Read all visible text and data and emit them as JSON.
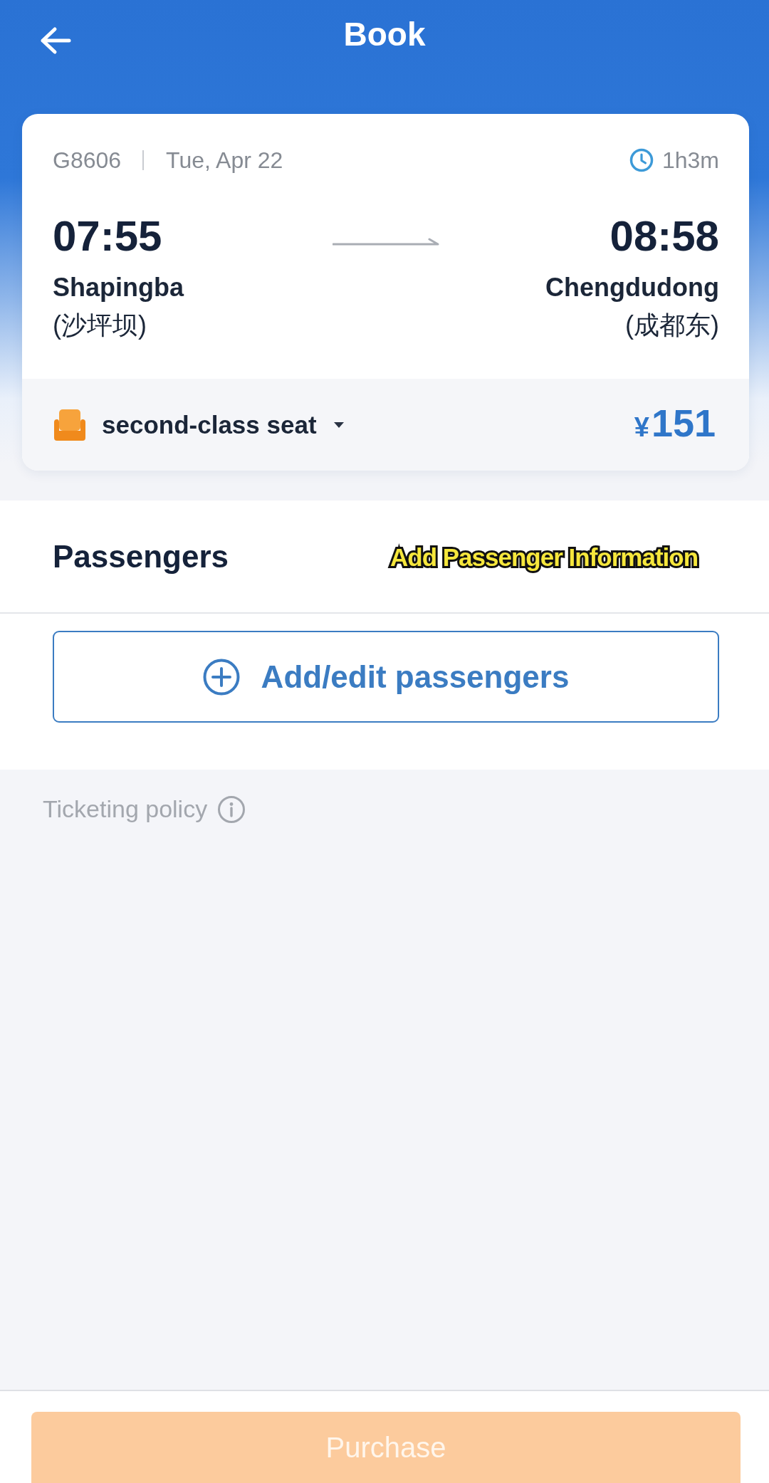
{
  "header": {
    "title": "Book"
  },
  "trip": {
    "train": "G8606",
    "date": "Tue, Apr 22",
    "duration": "1h3m",
    "departure": {
      "time": "07:55",
      "station": "Shapingba",
      "station_local": "(沙坪坝)"
    },
    "arrival": {
      "time": "08:58",
      "station": "Chengdudong",
      "station_local": "(成都东)"
    },
    "seat_class": "second-class seat",
    "price": {
      "currency": "¥",
      "amount": "151"
    }
  },
  "passengers": {
    "title": "Passengers",
    "add_button": "Add/edit passengers"
  },
  "caption_overlay": "Add Passenger Information",
  "policy": {
    "label": "Ticketing policy"
  },
  "footer": {
    "purchase_button": {
      "label": "Purchase",
      "disabled": true
    }
  }
}
